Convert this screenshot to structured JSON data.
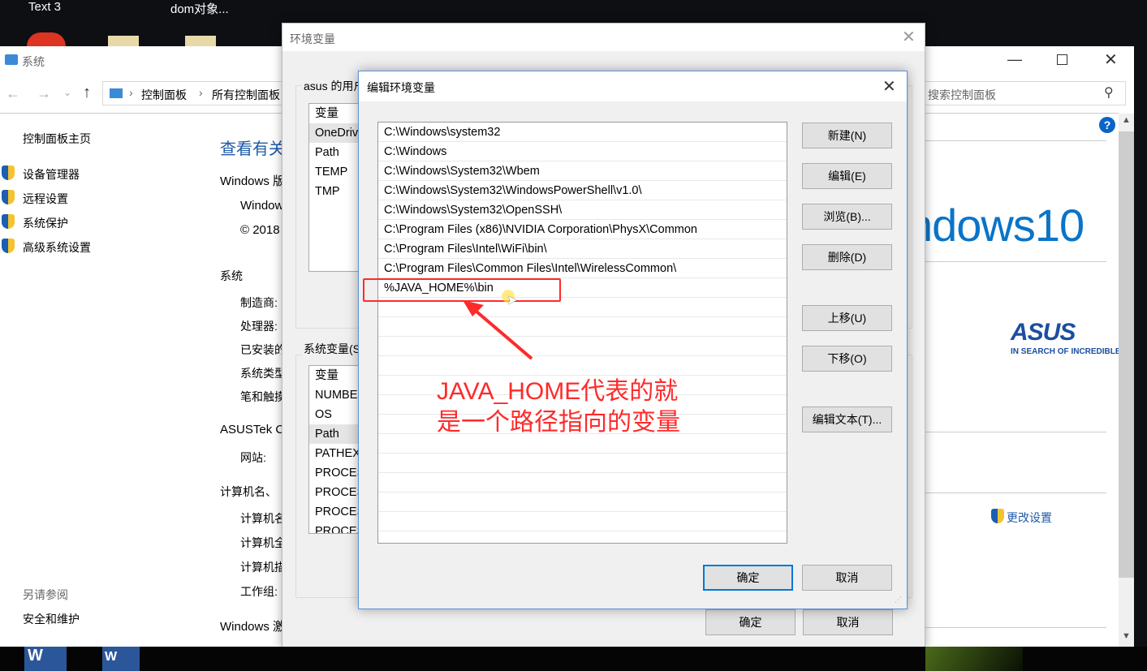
{
  "desktop": {
    "icons": [
      "Text 3",
      "dom对象..."
    ]
  },
  "system_window": {
    "title": "系统",
    "breadcrumb": [
      "控制面板",
      "所有控制面板"
    ],
    "search_placeholder": "搜索控制面板",
    "sidebar": {
      "home": "控制面板主页",
      "items": [
        "设备管理器",
        "远程设置",
        "系统保护",
        "高级系统设置"
      ],
      "see_also": "另请参阅",
      "see_also_items": [
        "安全和维护"
      ]
    },
    "main": {
      "heading": "查看有关",
      "windows_edition": "Windows 版",
      "edition_name": "Windows",
      "copyright": "© 2018",
      "system_section": "系统",
      "system_labels": [
        "制造商:",
        "处理器:",
        "已安装的",
        "系统类型",
        "笔和触摸"
      ],
      "oem_section": "ASUSTek C",
      "website": "网站:",
      "computer_section": "计算机名、",
      "computer_labels": [
        "计算机名",
        "计算机全",
        "计算机描",
        "工作组:"
      ],
      "activation": "Windows 激",
      "logo_text": "ndows10",
      "asus_tagline": "IN SEARCH OF INCREDIBLE",
      "asus_logo": "ASUS",
      "change_settings": "更改设置"
    }
  },
  "env_dialog": {
    "title": "环境变量",
    "user_group": "asus 的用户变量",
    "user_vars_header": "变量",
    "user_vars": [
      "OneDrive",
      "Path",
      "TEMP",
      "TMP"
    ],
    "sys_group": "系统变量(S)",
    "sys_vars_header": "变量",
    "sys_vars": [
      "NUMBER",
      "OS",
      "Path",
      "PATHEXT",
      "PROCESSOR",
      "PROCESSOR",
      "PROCESSOR",
      "PROCESSOR"
    ],
    "ok": "确定",
    "cancel": "取消"
  },
  "edit_dialog": {
    "title": "编辑环境变量",
    "entries": [
      "C:\\Windows\\system32",
      "C:\\Windows",
      "C:\\Windows\\System32\\Wbem",
      "C:\\Windows\\System32\\WindowsPowerShell\\v1.0\\",
      "C:\\Windows\\System32\\OpenSSH\\",
      "C:\\Program Files (x86)\\NVIDIA Corporation\\PhysX\\Common",
      "C:\\Program Files\\Intel\\WiFi\\bin\\",
      "C:\\Program Files\\Common Files\\Intel\\WirelessCommon\\",
      "%JAVA_HOME%\\bin"
    ],
    "buttons": {
      "new": "新建(N)",
      "edit": "编辑(E)",
      "browse": "浏览(B)...",
      "delete": "删除(D)",
      "move_up": "上移(U)",
      "move_down": "下移(O)",
      "edit_text": "编辑文本(T)..."
    },
    "ok": "确定",
    "cancel": "取消"
  },
  "annotation": {
    "text_line1": "JAVA_HOME代表的就",
    "text_line2": "是一个路径指向的变量",
    "color": "#ff2a2a"
  }
}
